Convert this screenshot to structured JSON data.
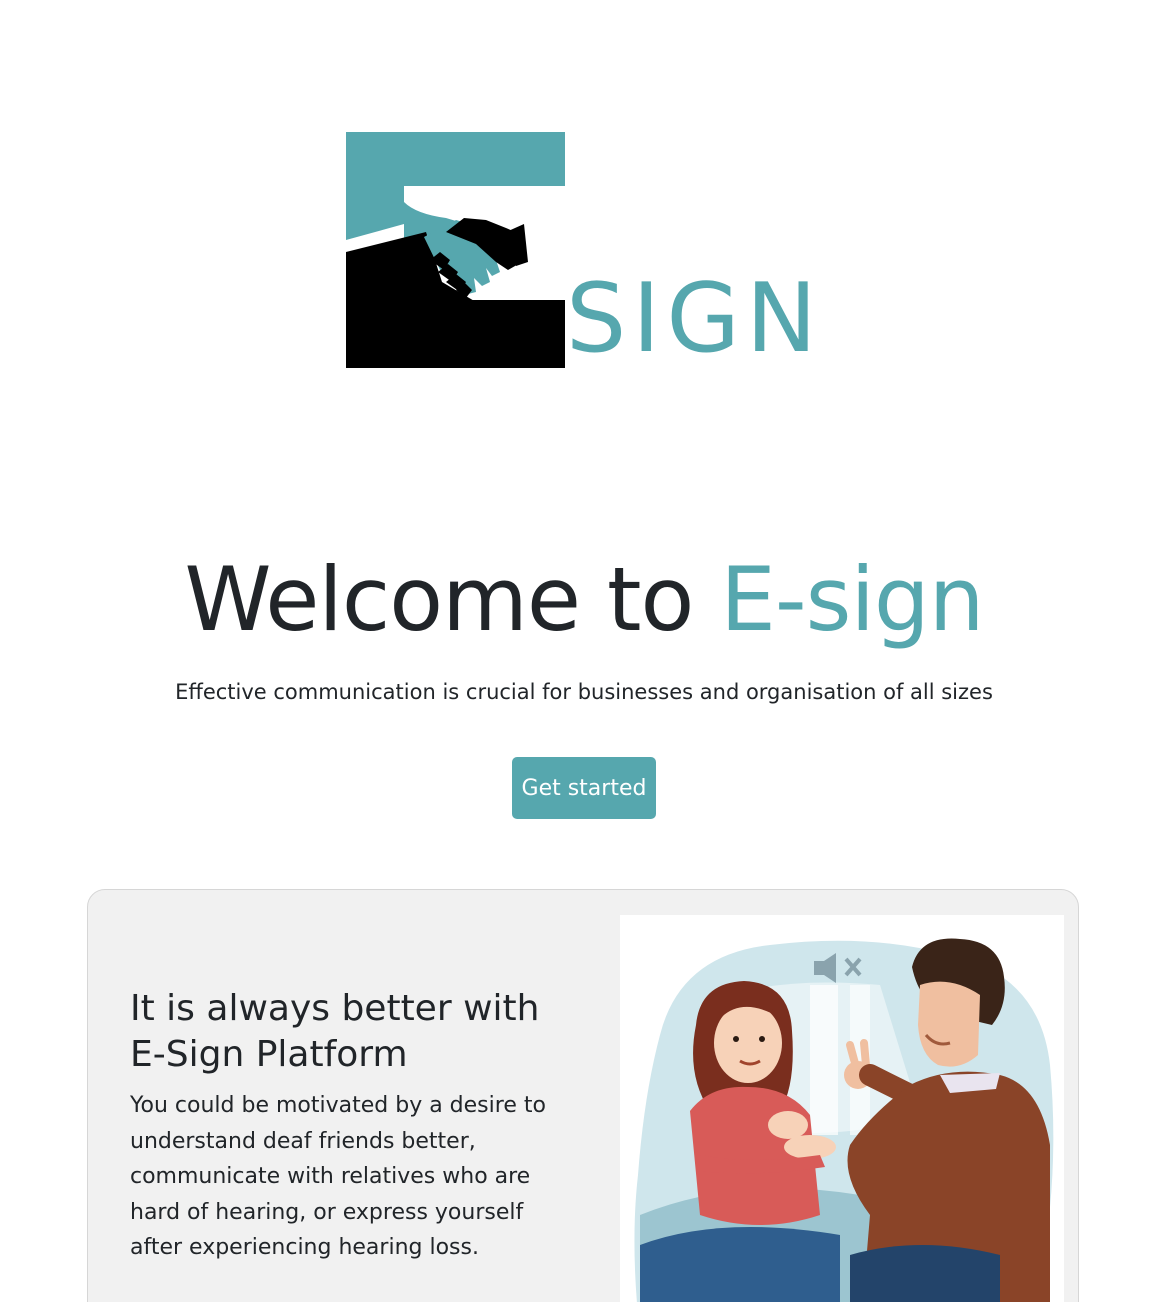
{
  "logo": {
    "text": "SIGN",
    "colors": {
      "teal": "#56a7ae",
      "dark": "#000000"
    }
  },
  "hero": {
    "title_prefix": "Welcome to ",
    "title_accent": "E-sign",
    "subtitle": "Effective communication is crucial for businesses and organisation of all sizes",
    "cta_label": "Get started"
  },
  "feature": {
    "title": "It is always better with E-Sign Platform",
    "body": "You could be motivated by a desire to understand deaf friends better, communicate with relatives who are hard of hearing, or express yourself after experiencing hearing loss.",
    "illustration": "sign-language-conversation-illustration",
    "mute_icon": "speaker-muted-icon"
  },
  "theme": {
    "accent": "#56a7ae",
    "text": "#212529",
    "card_bg": "#f1f1f1"
  }
}
